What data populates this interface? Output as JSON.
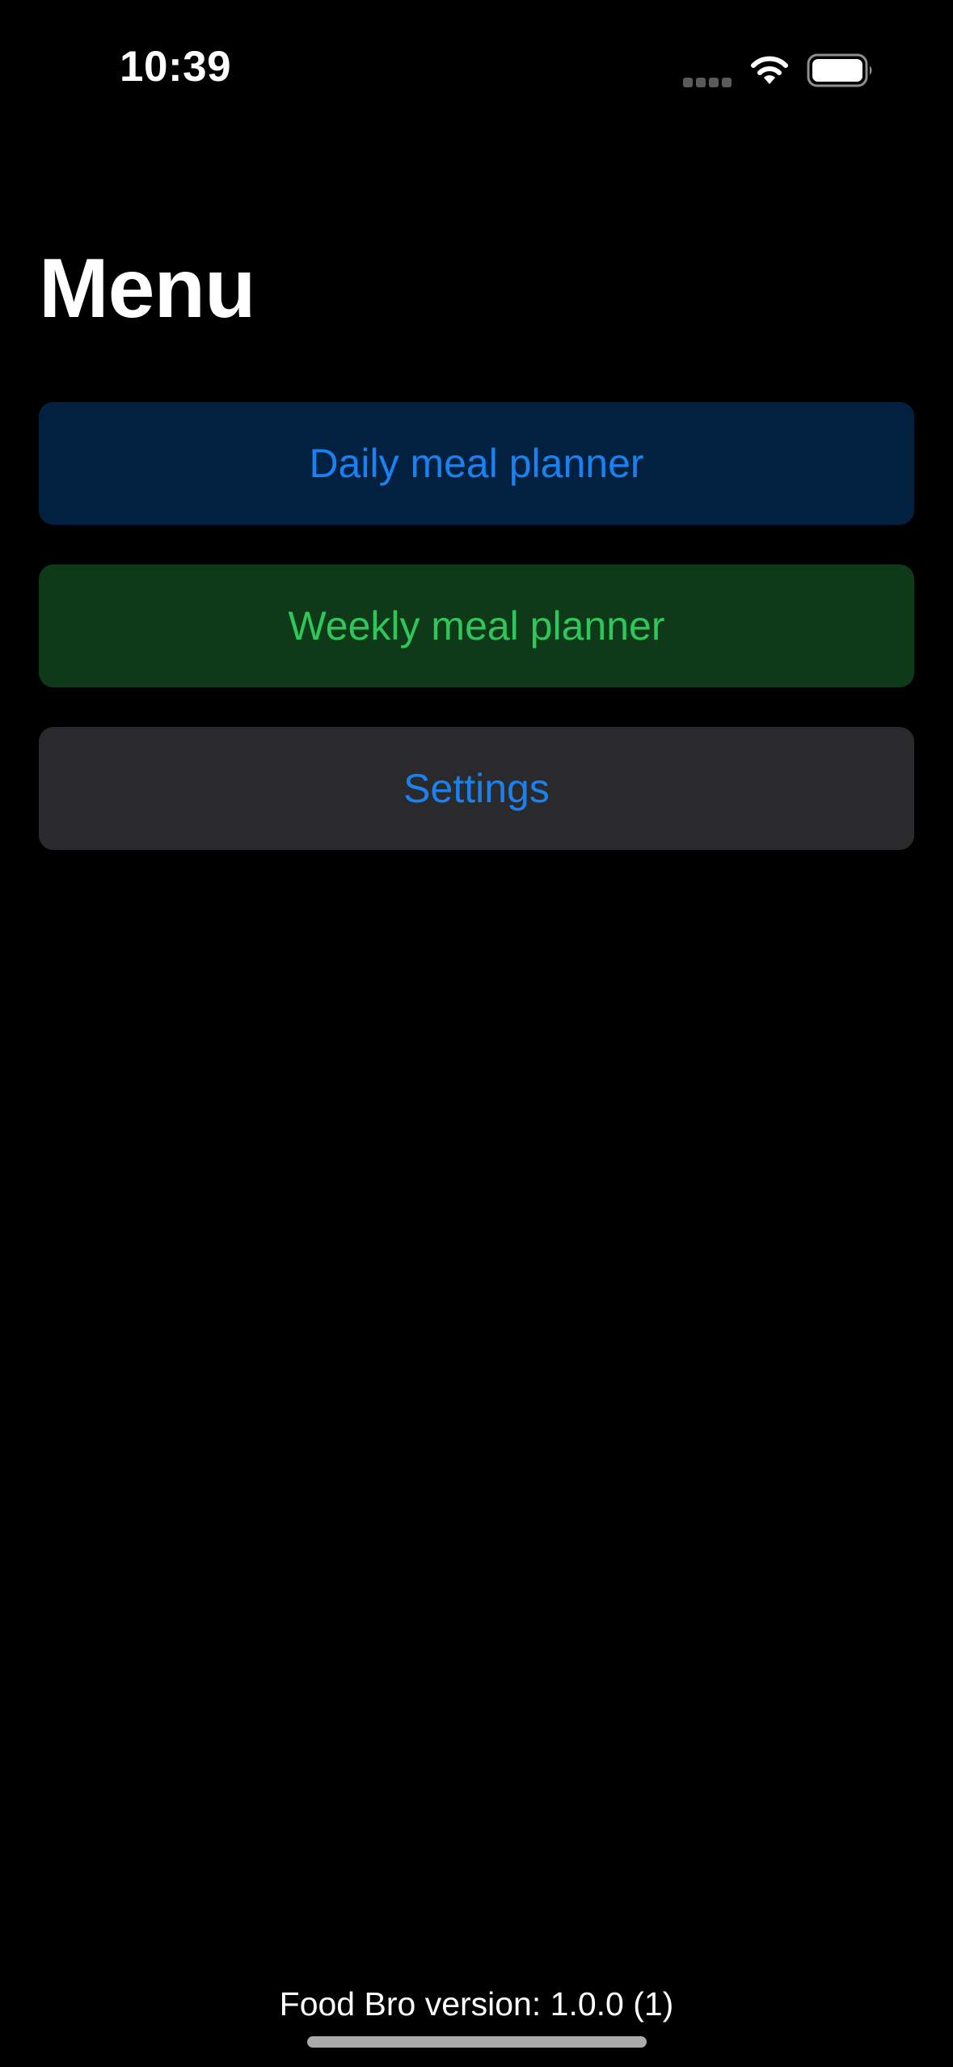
{
  "status_bar": {
    "time": "10:39",
    "icons": [
      "signal-dots-icon",
      "wifi-icon",
      "battery-icon"
    ]
  },
  "header": {
    "title": "Menu"
  },
  "menu": {
    "items": [
      {
        "label": "Daily meal planner",
        "bg_color": "#02203f",
        "text_color": "#1a82f0"
      },
      {
        "label": "Weekly meal planner",
        "bg_color": "#0e3a19",
        "text_color": "#30c75a"
      },
      {
        "label": "Settings",
        "bg_color": "#2a2a2c",
        "text_color": "#1a82f0"
      }
    ]
  },
  "footer": {
    "version": "Food Bro version: 1.0.0 (1)"
  },
  "colors": {
    "background": "#000000",
    "accent_blue": "#1a82f0",
    "accent_green": "#30c75a"
  }
}
